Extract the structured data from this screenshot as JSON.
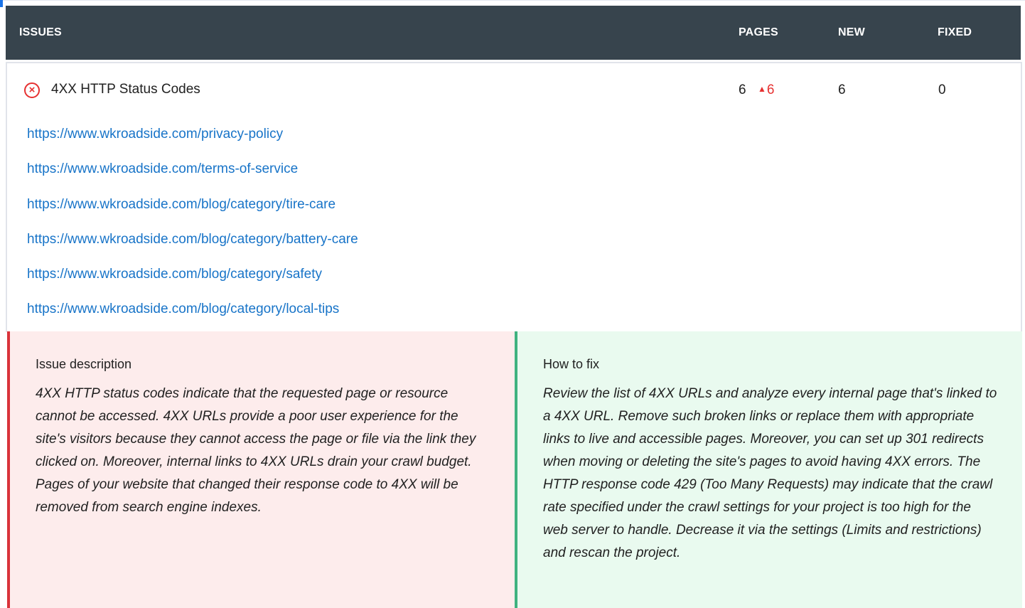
{
  "header": {
    "issues": "ISSUES",
    "pages": "PAGES",
    "new": "NEW",
    "fixed": "FIXED"
  },
  "issue": {
    "icon": "error-x-circle-icon",
    "title": "4XX HTTP Status Codes",
    "pages": "6",
    "pages_delta": "6",
    "new": "6",
    "fixed": "0",
    "urls": [
      "https://www.wkroadside.com/privacy-policy",
      "https://www.wkroadside.com/terms-of-service",
      "https://www.wkroadside.com/blog/category/tire-care",
      "https://www.wkroadside.com/blog/category/battery-care",
      "https://www.wkroadside.com/blog/category/safety",
      "https://www.wkroadside.com/blog/category/local-tips"
    ]
  },
  "description": {
    "heading": "Issue description",
    "body": "4XX HTTP status codes indicate that the requested page or resource cannot be accessed. 4XX URLs provide a poor user experience for the site's visitors because they cannot access the page or file via the link they clicked on. Moreover, internal links to 4XX URLs drain your crawl budget. Pages of your website that changed their response code to 4XX will be removed from search engine indexes."
  },
  "fix": {
    "heading": "How to fix",
    "body": "Review the list of 4XX URLs and analyze every internal page that's linked to a 4XX URL. Remove such broken links or replace them with appropriate links to live and accessible pages. Moreover, you can set up 301 redirects when moving or deleting the site's pages to avoid having 4XX errors. The HTTP response code 429 (Too Many Requests) may indicate that the crawl rate specified under the crawl settings for your project is too high for the web server to handle. Decrease it via the settings (Limits and restrictions) and rescan the project."
  },
  "colors": {
    "header_bg": "#37444d",
    "link": "#1874c8",
    "error": "#e63030",
    "desc_bg": "#fdecec",
    "desc_border": "#d9333a",
    "fix_bg": "#e9faef",
    "fix_border": "#3fb27f"
  }
}
